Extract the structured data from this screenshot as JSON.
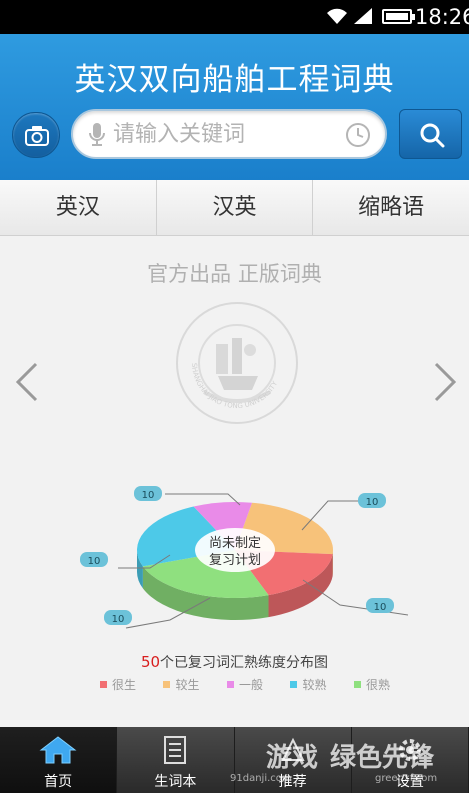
{
  "status_bar": {
    "time": "18:26",
    "battery_level": 1.0
  },
  "header": {
    "title": "英汉双向船舶工程词典",
    "search": {
      "placeholder": "请输入关键词",
      "value": ""
    }
  },
  "tabs": [
    {
      "label": "英汉"
    },
    {
      "label": "汉英"
    },
    {
      "label": "缩略语"
    }
  ],
  "main": {
    "slogan": "官方出品 正版词典",
    "logo_text": "SHANGHAI JIAO TONG UNIVERSITY",
    "chart_caption_num": "50",
    "chart_caption_text": "个已复习词汇熟练度分布图"
  },
  "chart_data": {
    "type": "pie",
    "center_label_line1": "尚未制定",
    "center_label_line2": "复习计划",
    "categories": [
      "很生",
      "较生",
      "一般",
      "较熟",
      "很熟"
    ],
    "values": [
      10,
      10,
      10,
      10,
      10
    ],
    "colors": [
      "#f26f72",
      "#f7c27a",
      "#e98be8",
      "#4dc9e8",
      "#8fe07f"
    ],
    "labels": [
      "10",
      "10",
      "10",
      "10",
      "10"
    ],
    "legend_position": "bottom"
  },
  "bottom_nav": [
    {
      "label": "首页",
      "icon": "home-icon",
      "active": true
    },
    {
      "label": "生词本",
      "icon": "notebook-icon",
      "active": false
    },
    {
      "label": "推荐",
      "icon": "recommend-icon",
      "active": false
    },
    {
      "label": "设置",
      "icon": "gear-icon",
      "active": false
    }
  ],
  "watermark": {
    "brand": "游戏",
    "url": "91danji.com",
    "brand2": "绿色先锋",
    "url2": "greenxf.com"
  }
}
